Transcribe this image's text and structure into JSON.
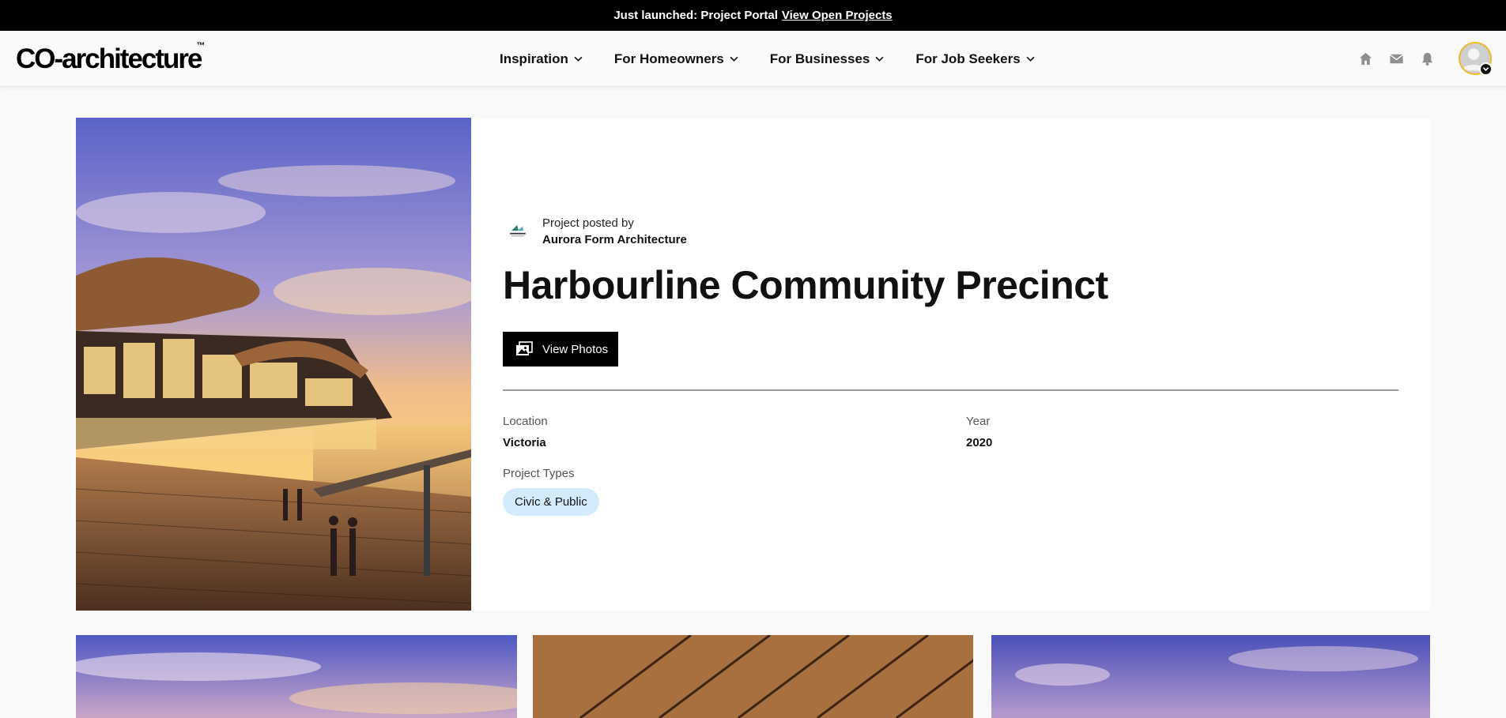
{
  "announcement": {
    "text": "Just launched: Project Portal",
    "link": "View Open Projects"
  },
  "header": {
    "logo": "CO-architecture",
    "logo_mark": "™",
    "menu": [
      {
        "label": "Inspiration"
      },
      {
        "label": "For Homeowners"
      },
      {
        "label": "For Businesses"
      },
      {
        "label": "For Job Seekers"
      }
    ],
    "icons": [
      "home-icon",
      "mail-icon",
      "bell-icon",
      "avatar",
      "chevron-down-icon"
    ]
  },
  "project": {
    "posted_by_label": "Project posted by",
    "posted_by": "Aurora Form Architecture",
    "title": "Harbourline Community Precinct",
    "view_photos": "View Photos",
    "location_label": "Location",
    "location": "Victoria",
    "year_label": "Year",
    "year": "2020",
    "types_label": "Project Types",
    "types": [
      "Civic & Public"
    ]
  },
  "colors": {
    "announcement_bg": "#000000",
    "button_bg": "#000000",
    "pill_bg": "#d3ebfb",
    "avatar_ring": "#f0b92a"
  }
}
